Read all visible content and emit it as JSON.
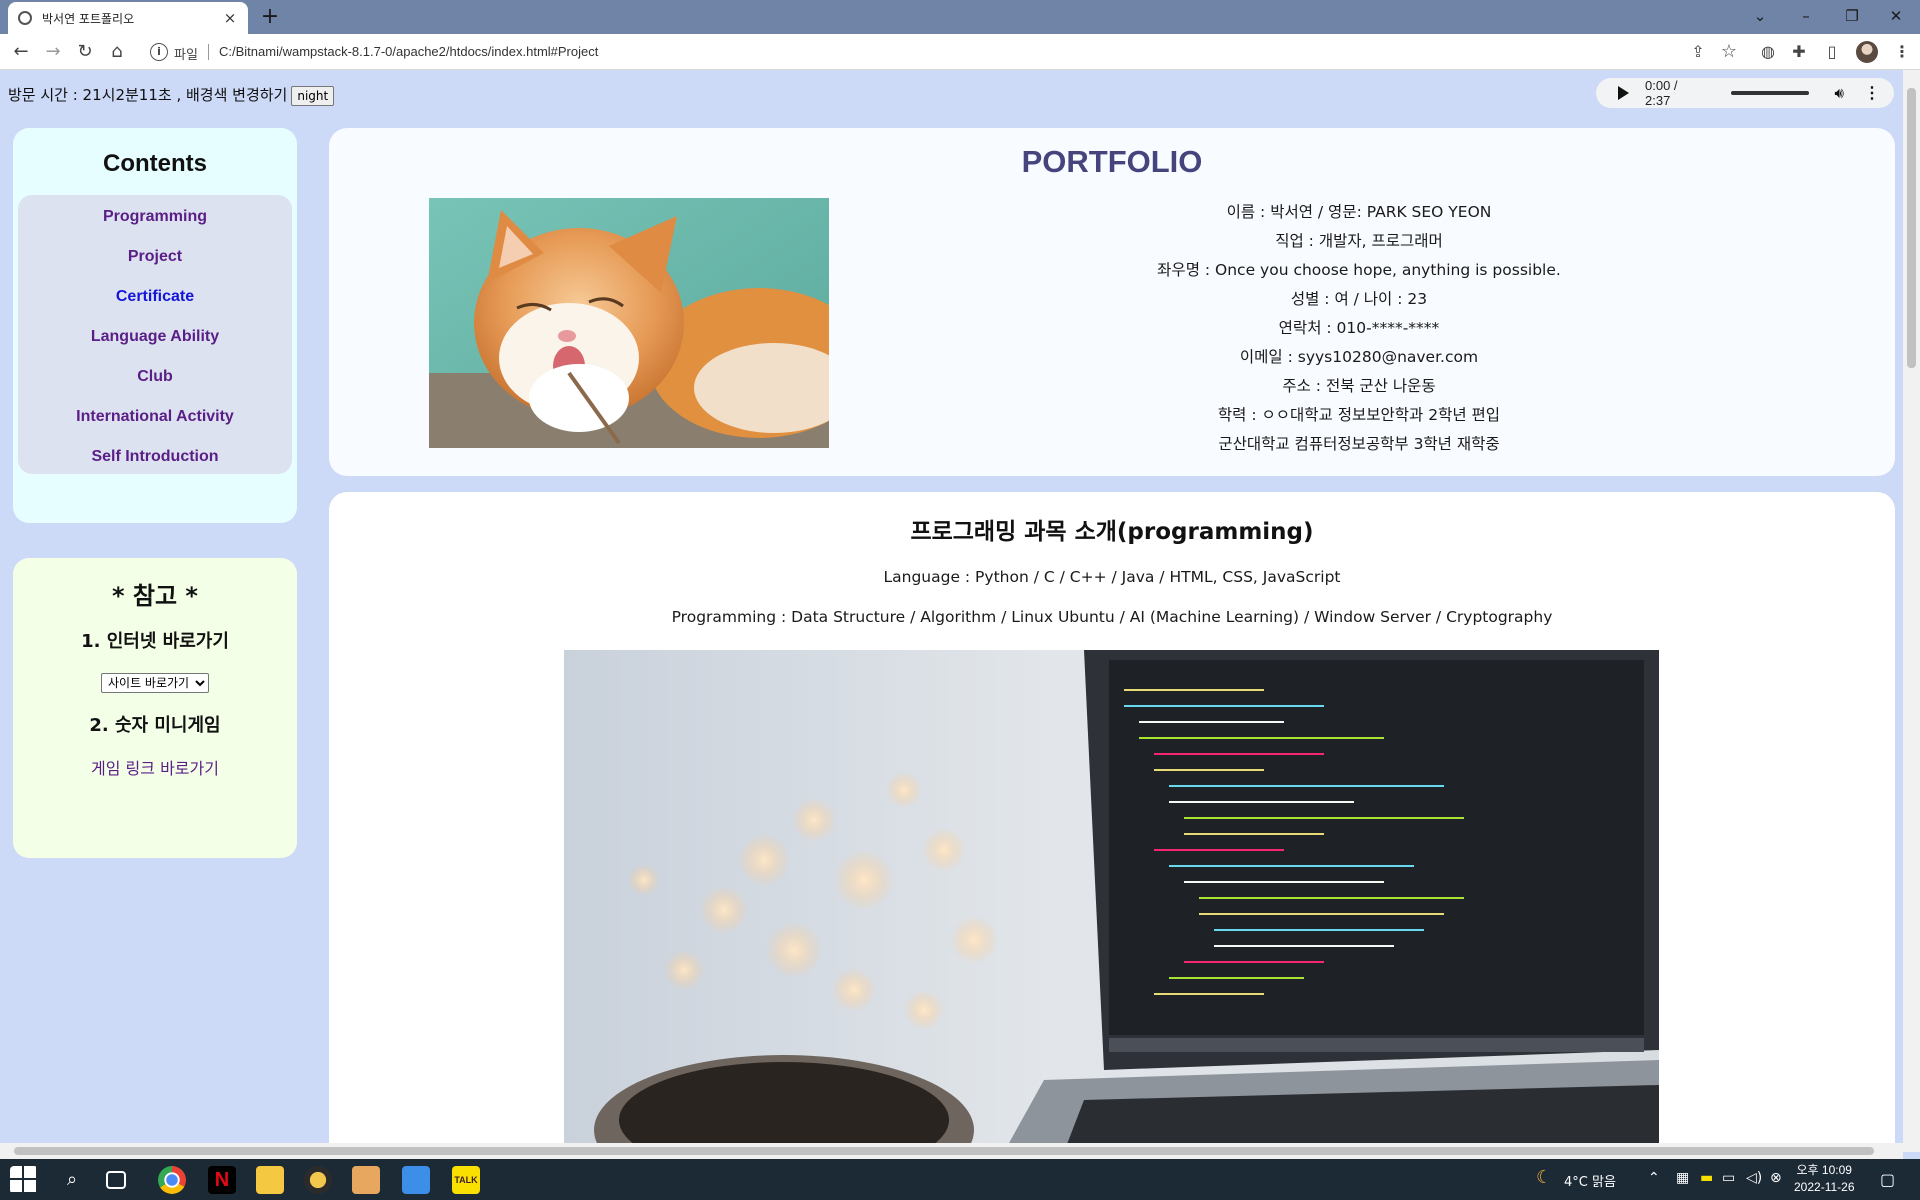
{
  "browser": {
    "tab_title": "박서연 포트폴리오",
    "tab_close": "×",
    "new_tab": "+",
    "window_min": "⌄",
    "window_minimize": "–",
    "window_restore": "❐",
    "window_close": "✕",
    "address_label": "파일",
    "address_url": "C:/Bitnami/wampstack-8.1.7-0/apache2/htdocs/index.html#Project"
  },
  "top": {
    "visit_text": "방문 시간 : 21시2분11초 , 배경색 변경하기",
    "night_button": "night"
  },
  "audio": {
    "time": "0:00 / 2:37",
    "progress": 0,
    "volume": 0.9
  },
  "sidebar": {
    "title": "Contents",
    "items": [
      {
        "label": "Programming"
      },
      {
        "label": "Project"
      },
      {
        "label": "Certificate"
      },
      {
        "label": "Language Ability"
      },
      {
        "label": "Club"
      },
      {
        "label": "International Activity"
      },
      {
        "label": "Self Introduction"
      }
    ]
  },
  "reference": {
    "title": "* 참고 *",
    "section1": "1. 인터넷 바로가기",
    "select_value": "사이트 바로가기",
    "section2": "2. 숫자 미니게임",
    "game_link": "게임 링크 바로가기"
  },
  "profile": {
    "title": "PORTFOLIO",
    "lines": [
      "이름 : 박서연 / 영문: PARK SEO YEON",
      "직업 : 개발자, 프로그래머",
      "좌우명 : Once you choose hope, anything is possible.",
      "성별 : 여 / 나이 : 23",
      "연락처 : 010-****-****",
      "이메일 : syys10280@naver.com",
      "주소 : 전북 군산 나운동",
      "학력 : ㅇㅇ대학교 정보보안학과 2학년 편입",
      "군산대학교 컴퓨터정보공학부 3학년 재학중"
    ]
  },
  "programming": {
    "title": "프로그래밍 과목 소개(programming)",
    "language": "Language : Python / C / C++ / Java / HTML, CSS, JavaScript",
    "subjects": "Programming : Data Structure / Algorithm / Linux Ubuntu / AI (Machine Learning) / Window Server / Cryptography"
  },
  "taskbar": {
    "weather": "4°C 맑음",
    "time": "오후 10:09",
    "date": "2022-11-26"
  },
  "colors": {
    "page_bg": "#ccd9f7",
    "menu_link": "#5a1f86",
    "menu_link_visited": "#1515d8",
    "portfolio_title": "#45447c"
  }
}
